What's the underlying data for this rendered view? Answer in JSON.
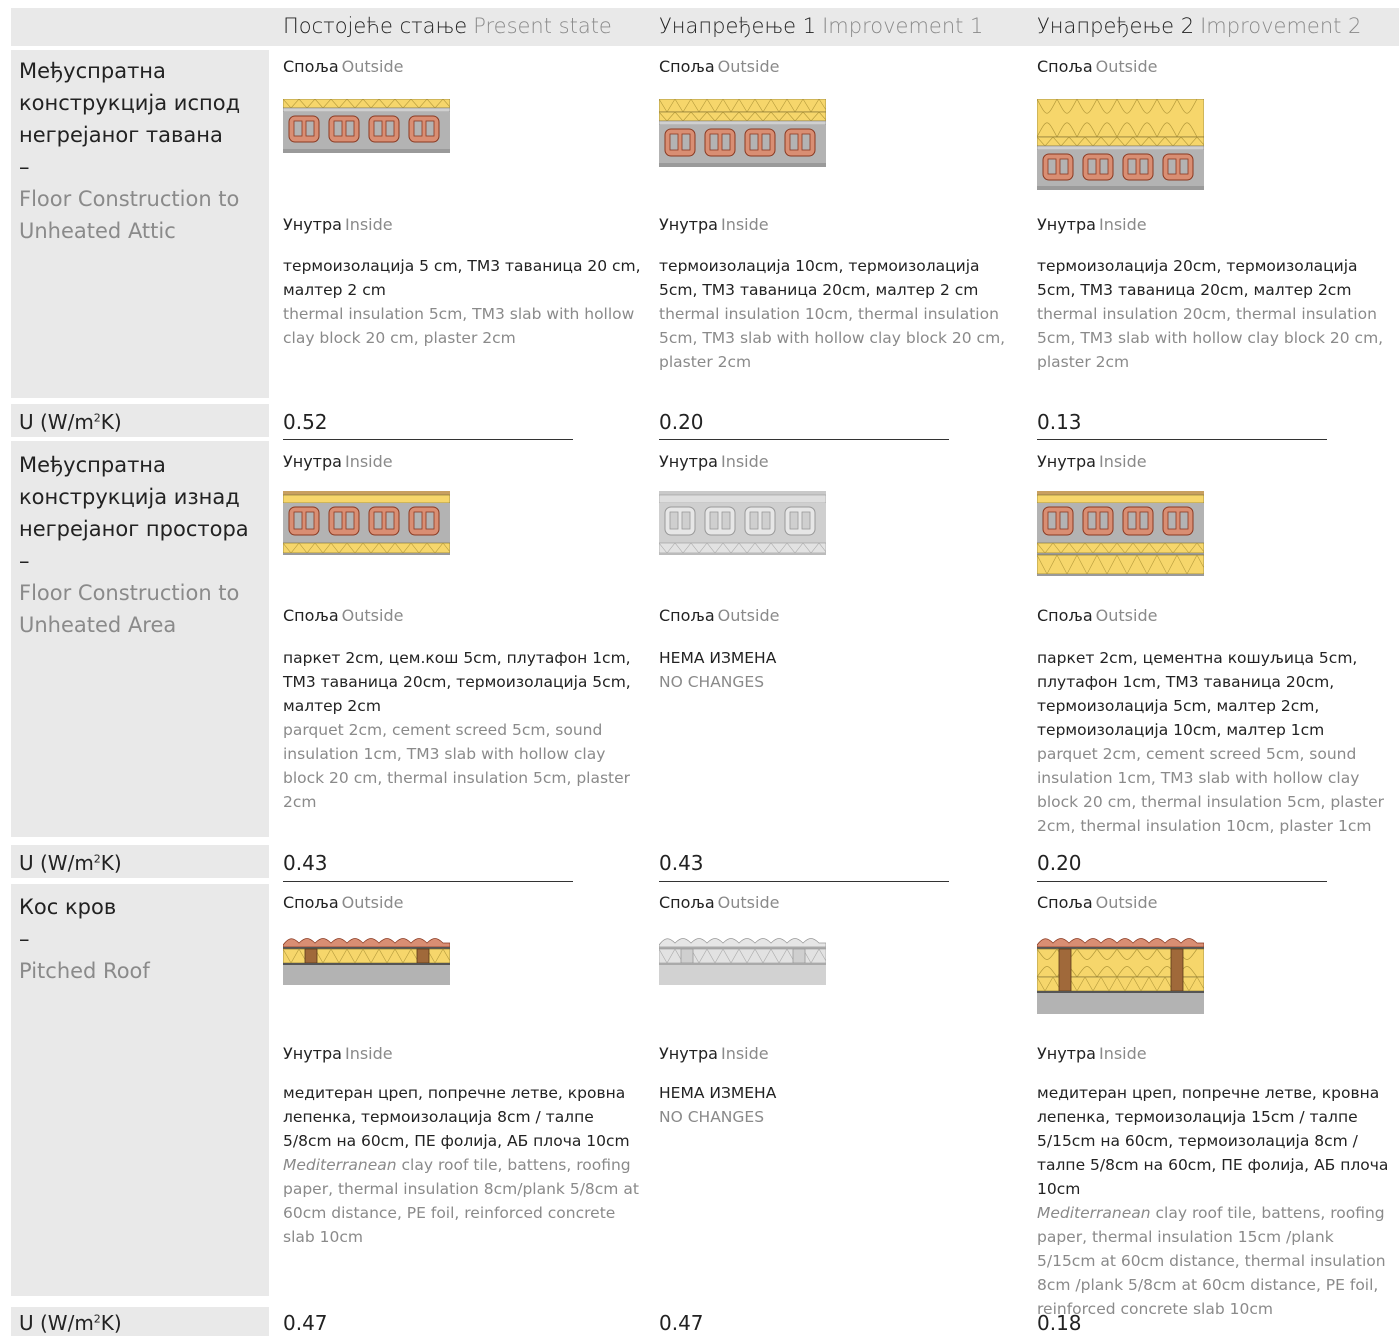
{
  "columns": [
    {
      "sr": "Постојеће стање",
      "en": "Present state"
    },
    {
      "sr": "Унапређење 1",
      "en": "Improvement 1"
    },
    {
      "sr": "Унапређење 2",
      "en": "Improvement 2"
    }
  ],
  "labels": {
    "outside_sr": "Споља",
    "outside_en": "Outside",
    "inside_sr": "Унутра",
    "inside_en": "Inside",
    "u_label": "U (W/m",
    "u_sup": "2",
    "u_tail": "K)",
    "dash": "–"
  },
  "rows": [
    {
      "title_sr": "Међуспратна конструкција испод негрејаног тавана",
      "title_en": "Floor Construction to Unheated Attic",
      "cells": [
        {
          "sr": "термоизолација 5 cm, ТМ3 таваница 20 cm, малтер 2 cm",
          "en": "thermal insulation 5cm, TM3 slab with hollow clay block 20 cm, plaster 2cm",
          "u": "0.52"
        },
        {
          "sr": "термоизолација 10cm, термоизолација 5cm, ТМ3 таваница 20cm, малтер 2 cm",
          "en": "thermal insulation 10cm, thermal insulation 5cm, TM3 slab with hollow clay block 20 cm, plaster 2cm",
          "u": "0.20"
        },
        {
          "sr": "термоизолација 20cm, термоизолација 5cm, ТМ3 таваница 20cm, малтер 2cm",
          "en": "thermal insulation 20cm, thermal insulation 5cm, TM3 slab with hollow clay block 20 cm, plaster 2cm",
          "u": "0.13"
        }
      ]
    },
    {
      "title_sr": "Међуспратна конструкција изнад негрејаног простора",
      "title_en": "Floor Construction to Unheated Area",
      "cells": [
        {
          "sr": "паркет 2cm, цем.кош 5cm, плутафон 1cm, ТМ3 таваница 20cm, термоизолација 5cm, малтер 2cm",
          "en": "parquet 2cm, cement screed 5cm, sound insulation 1cm, TM3 slab with hollow clay block 20 cm, thermal insulation 5cm, plaster 2cm",
          "u": "0.43"
        },
        {
          "sr": "НЕМА ИЗМЕНА",
          "en": "NO CHANGES",
          "u": "0.43"
        },
        {
          "sr": "паркет 2cm, цементна кошуљица 5cm, плутафон 1cm, ТМ3 таваница 20cm, термоизолација 5cm, малтер 2cm, термоизолација 10cm, малтер 1cm",
          "en": "parquet 2cm, cement screed 5cm, sound insulation 1cm, TM3 slab with hollow clay block 20 cm, thermal insulation 5cm, plaster 2cm, thermal insulation 10cm, plaster 1cm",
          "u": "0.20"
        }
      ]
    },
    {
      "title_sr": "Кос кров",
      "title_en": "Pitched Roof",
      "cells": [
        {
          "sr": "медитеран цреп, попречне летве, кровна лепенка, термоизолација 8cm / талпе 5/8cm на 60cm,  ПЕ фолија, АБ плоча 10cm",
          "en_it": "Mediterranean",
          "en": " clay roof tile, battens, roofing paper, thermal insulation 8cm/plank 5/8cm at 60cm distance, PE foil, reinforced concrete slab 10cm",
          "u": "0.47"
        },
        {
          "sr": "НЕМА ИЗМЕНА",
          "en": "NO CHANGES",
          "u": "0.47"
        },
        {
          "sr": "медитеран цреп, попречне летве, кровна лепенка, термоизолација 15cm / талпе 5/15cm на 60cm, термоизолација 8cm / талпе 5/8cm на 60cm, ПЕ фолија, АБ плоча 10cm",
          "en_it": "Mediterranean",
          "en": " clay roof tile, battens, roofing paper, thermal insulation 15cm /plank 5/15cm at 60cm distance, thermal insulation 8cm /plank 5/8cm at 60cm distance, PE foil, reinforced concrete slab 10cm",
          "u": "0.18"
        }
      ]
    }
  ],
  "colors": {
    "band": "#e9e9e9",
    "insulation": "#f6d66b",
    "clay": "#c8745a",
    "concrete": "#a8a8a8",
    "timber": "#a0693a",
    "muted_text": "#8a8a8a"
  }
}
